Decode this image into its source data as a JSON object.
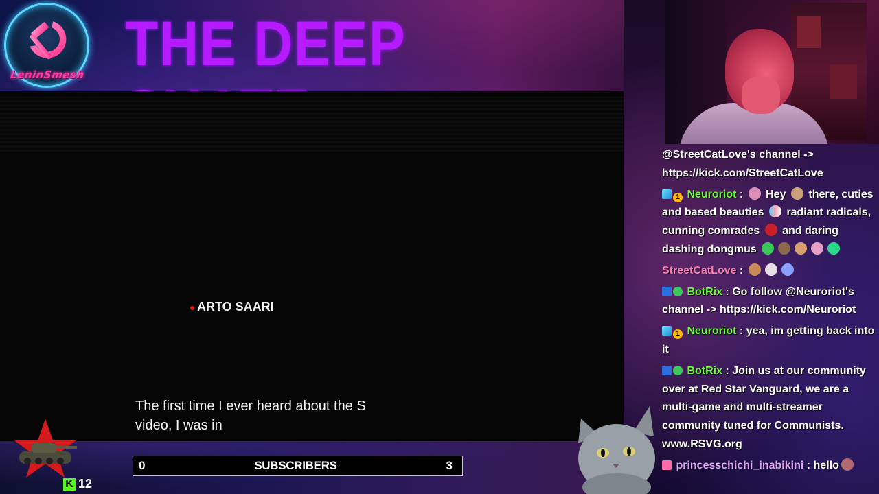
{
  "banner": {
    "logo_text": "LeninSmesh",
    "title": "THE DEEP SKATE"
  },
  "video": {
    "credit_name": "ARTO SAARI",
    "subtitle_line1": "The first time I ever heard about the S",
    "subtitle_line2": "video, I was in"
  },
  "bottom": {
    "kick_count": "12",
    "sub_bar": {
      "left": "0",
      "label": "SUBSCRIBERS",
      "right": "3"
    }
  },
  "chat": {
    "messages": [
      {
        "text": "@StreetCatLove's channel -> https://kick.com/StreetCatLove"
      },
      {
        "user": "Neuroriot",
        "sep": " : ",
        "text_a": " Hey ",
        "text_b": " there, cuties and based beauties ",
        "text_c": " radiant radicals, cunning comrades ",
        "text_d": " and daring dashing dongmus "
      },
      {
        "user": "StreetCatLove",
        "sep": " : "
      },
      {
        "user": "BotRix",
        "sep": " : ",
        "text": "Go follow @Neuroriot's channel -> https://kick.com/Neuroriot"
      },
      {
        "user": "Neuroriot",
        "sep": " : ",
        "text": "yea, im getting back into it"
      },
      {
        "user": "BotRix",
        "sep": " : ",
        "text": "Join us at our community over at Red Star Vanguard, we are a multi-game and multi-streamer community tuned for Communists. www.RSVG.org"
      },
      {
        "user": "princesschichi_inabikini",
        "sep": " : ",
        "text": "hello"
      }
    ],
    "badge_number": "1"
  },
  "colors": {
    "title_purple": "#b61bff",
    "kick_green": "#53fc18",
    "name_green": "#6bfc3a",
    "name_pink": "#ff7bbd",
    "name_violet": "#e0a6ff"
  }
}
